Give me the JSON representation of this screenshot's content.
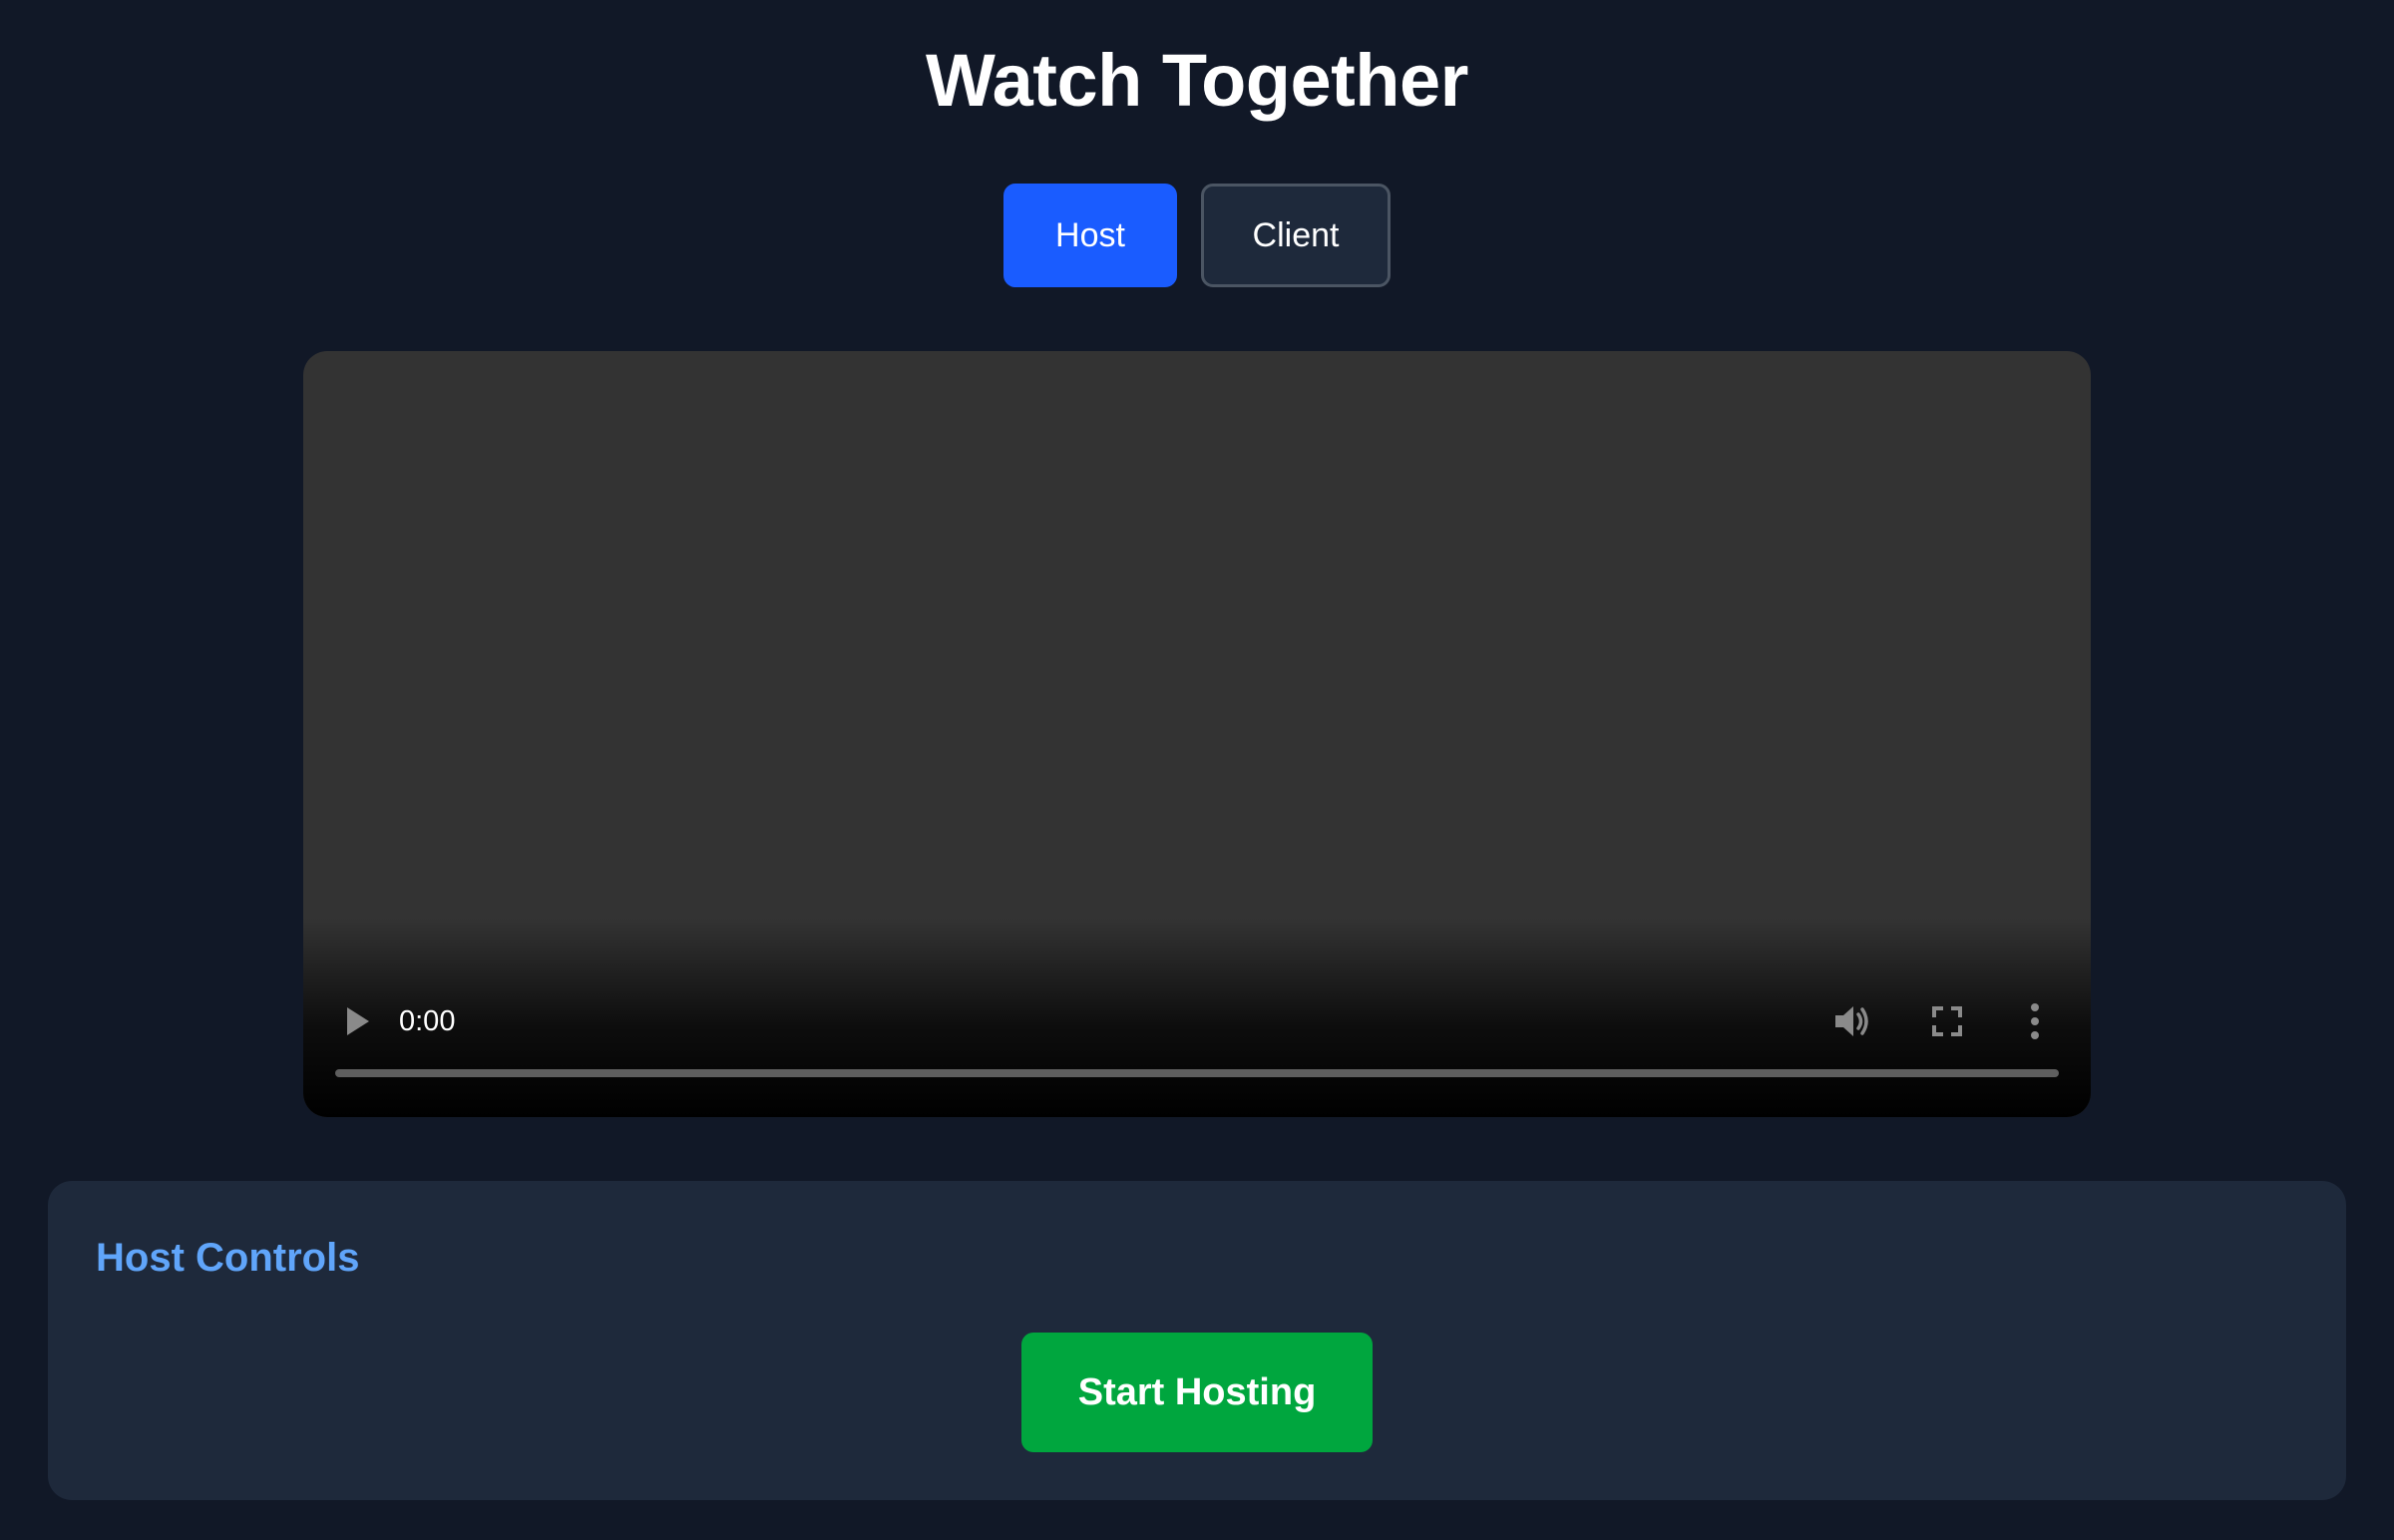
{
  "header": {
    "title": "Watch Together"
  },
  "mode_switch": {
    "host_label": "Host",
    "client_label": "Client",
    "selected": "Host"
  },
  "video_player": {
    "current_time": "0:00",
    "progress": 0,
    "icons": [
      "play-icon",
      "volume-icon",
      "fullscreen-icon",
      "more-options-icon"
    ]
  },
  "host_controls": {
    "title": "Host Controls",
    "start_button_label": "Start Hosting"
  },
  "colors": {
    "background": "#111827",
    "panel": "#1e293b",
    "host_button": "#1a5cff",
    "start_button": "#00a63e",
    "panel_title": "#60a5fa",
    "video_background": "#333333"
  }
}
